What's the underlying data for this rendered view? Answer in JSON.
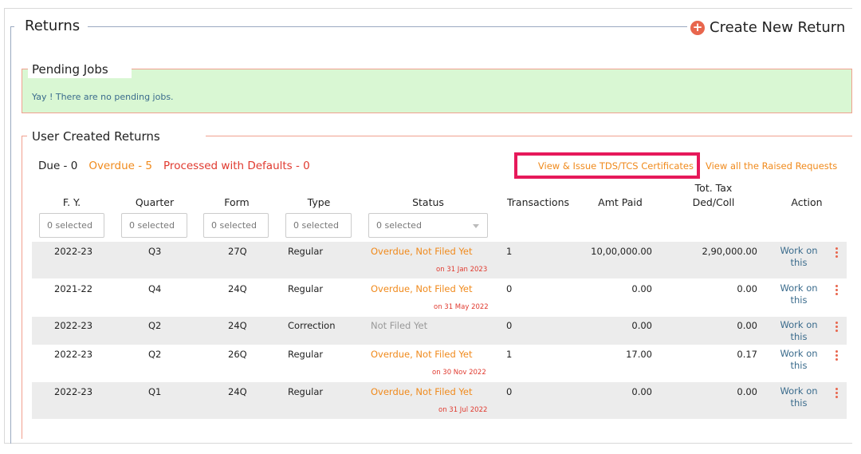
{
  "header": {
    "title": "Returns",
    "create_label": "Create New Return",
    "create_icon": "plus-circle-icon"
  },
  "pending": {
    "title": "Pending Jobs",
    "message": "Yay ! There are no pending jobs."
  },
  "user_returns": {
    "title": "User Created Returns",
    "due": "Due - 0",
    "overdue": "Overdue - 5",
    "defaults": "Processed with Defaults - 0",
    "view_issue_label": "View & Issue TDS/TCS Certificates",
    "raised_label": "View all the Raised Requests"
  },
  "columns": {
    "fy": "F. Y.",
    "quarter": "Quarter",
    "form": "Form",
    "type": "Type",
    "status": "Status",
    "transactions": "Transactions",
    "amt_paid": "Amt Paid",
    "tot_tax_1": "Tot. Tax",
    "tot_tax_2": "Ded/Coll",
    "action": "Action"
  },
  "filters": {
    "fy": "0 selected",
    "quarter": "0 selected",
    "form": "0 selected",
    "type": "0 selected",
    "status": "0 selected"
  },
  "rows": [
    {
      "fy": "2022-23",
      "quarter": "Q3",
      "form": "27Q",
      "type": "Regular",
      "status": "Overdue, Not Filed Yet",
      "due_date": "on 31 Jan 2023",
      "transactions": "1",
      "amt_paid": "10,00,000.00",
      "tot_tax": "2,90,000.00",
      "action_1": "Work on",
      "action_2": "this"
    },
    {
      "fy": "2021-22",
      "quarter": "Q4",
      "form": "24Q",
      "type": "Regular",
      "status": "Overdue, Not Filed Yet",
      "due_date": "on 31 May 2022",
      "transactions": "0",
      "amt_paid": "0.00",
      "tot_tax": "0.00",
      "action_1": "Work on",
      "action_2": "this"
    },
    {
      "fy": "2022-23",
      "quarter": "Q2",
      "form": "24Q",
      "type": "Correction",
      "status": "Not Filed Yet",
      "due_date": "",
      "transactions": "0",
      "amt_paid": "0.00",
      "tot_tax": "0.00",
      "action_1": "Work on",
      "action_2": "this"
    },
    {
      "fy": "2022-23",
      "quarter": "Q2",
      "form": "26Q",
      "type": "Regular",
      "status": "Overdue, Not Filed Yet",
      "due_date": "on 30 Nov 2022",
      "transactions": "1",
      "amt_paid": "17.00",
      "tot_tax": "0.17",
      "action_1": "Work on",
      "action_2": "this"
    },
    {
      "fy": "2022-23",
      "quarter": "Q1",
      "form": "24Q",
      "type": "Regular",
      "status": "Overdue, Not Filed Yet",
      "due_date": "on 31 Jul 2022",
      "transactions": "0",
      "amt_paid": "0.00",
      "tot_tax": "0.00",
      "action_1": "Work on",
      "action_2": "this"
    }
  ]
}
